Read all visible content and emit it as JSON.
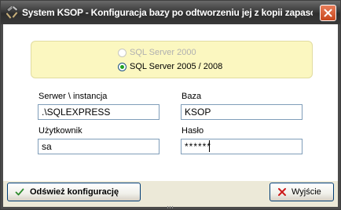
{
  "window": {
    "title": "System KSOP - Konfiguracja bazy po odtworzeniu jej z kopii zapaso..."
  },
  "icons": {
    "app": "tools-hammer-icon",
    "close": "close-x-icon",
    "refresh": "checkmark-icon",
    "exit": "x-mark-icon"
  },
  "colors": {
    "version_box_bg": "#fbf7c0",
    "checked_dot": "#21a121",
    "close_button": "#c8461c",
    "exit_icon": "#cc1a1a",
    "refresh_icon": "#2e8b2e"
  },
  "server_version": {
    "options": [
      {
        "label": "SQL Server 2000",
        "enabled": false,
        "selected": false
      },
      {
        "label": "SQL Server 2005 / 2008",
        "enabled": true,
        "selected": true
      }
    ]
  },
  "fields": {
    "server": {
      "label": "Serwer \\ instancja",
      "value": ".\\SQLEXPRESS"
    },
    "database": {
      "label": "Baza",
      "value": "KSOP"
    },
    "user": {
      "label": "Użytkownik",
      "value": "sa"
    },
    "password": {
      "label": "Hasło",
      "value": "******"
    }
  },
  "buttons": {
    "refresh_label": "Odśwież konfigurację",
    "exit_label": "Wyjście"
  }
}
